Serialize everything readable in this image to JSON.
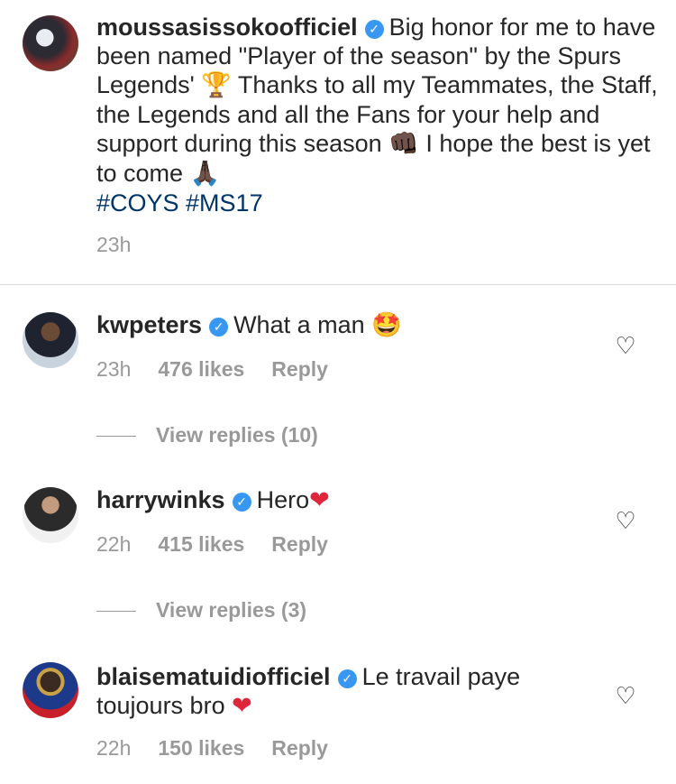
{
  "post": {
    "username": "moussasissokoofficiel",
    "caption_1": "Big honor for me to have been named \"Player of the season\" by the Spurs Legends'",
    "emoji_trophy": "🏆",
    "caption_2": " Thanks to all my Teammates, the Staff, the Legends and all the Fans for your help and support during this season",
    "emoji_fist": "👊🏿",
    "caption_3": " I hope the best is yet to come",
    "emoji_pray": "🙏🏿",
    "hashtags": "#COYS #MS17",
    "time": "23h"
  },
  "comments": [
    {
      "username": "kwpeters",
      "text": "What a man",
      "emoji": "🤩",
      "time": "23h",
      "likes": "476 likes",
      "reply_label": "Reply",
      "view_replies": "View replies (10)"
    },
    {
      "username": "harrywinks",
      "text": "Hero",
      "emoji": "❤",
      "time": "22h",
      "likes": "415 likes",
      "reply_label": "Reply",
      "view_replies": "View replies (3)"
    },
    {
      "username": "blaisematuidiofficiel",
      "text": "Le travail paye toujours bro",
      "emoji": "❤",
      "time": "22h",
      "likes": "150 likes",
      "reply_label": "Reply"
    }
  ],
  "icons": {
    "verified": "verified-badge-icon",
    "like": "heart-outline-icon"
  },
  "colors": {
    "verified": "#3897f0",
    "hashtag": "#003569",
    "meta": "#999999",
    "heart": "#e0263b"
  }
}
